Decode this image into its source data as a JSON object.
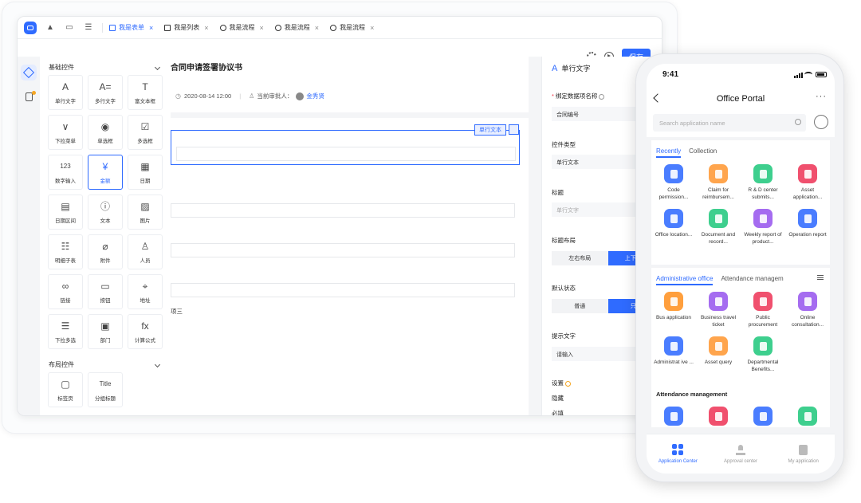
{
  "designer": {
    "tabs": [
      {
        "label": "我是表单",
        "active": true
      },
      {
        "label": "我是列表",
        "active": false
      },
      {
        "label": "我是流程",
        "active": false
      },
      {
        "label": "我是流程",
        "active": false
      },
      {
        "label": "我是流程",
        "active": false
      }
    ],
    "save_label": "保存",
    "palette": {
      "basic_header": "基础控件",
      "basic_items": [
        {
          "glyph": "A",
          "label": "单行文字"
        },
        {
          "glyph": "A=",
          "label": "多行文字"
        },
        {
          "glyph": "T",
          "label": "富文本框"
        },
        {
          "glyph": "∨",
          "label": "下拉菜单"
        },
        {
          "glyph": "◉",
          "label": "单选框"
        },
        {
          "glyph": "☑",
          "label": "多选框"
        },
        {
          "glyph": "123",
          "label": "数字输入"
        },
        {
          "glyph": "¥",
          "label": "金额",
          "selected": true
        },
        {
          "glyph": "▦",
          "label": "日期"
        },
        {
          "glyph": "▤",
          "label": "日期区间"
        },
        {
          "glyph": "ⓘ",
          "label": "文本"
        },
        {
          "glyph": "▨",
          "label": "图片"
        },
        {
          "glyph": "☷",
          "label": "明细子表"
        },
        {
          "glyph": "⌀",
          "label": "附件"
        },
        {
          "glyph": "♙",
          "label": "人员"
        },
        {
          "glyph": "∞",
          "label": "链接"
        },
        {
          "glyph": "▭",
          "label": "按钮"
        },
        {
          "glyph": "⌖",
          "label": "地址"
        },
        {
          "glyph": "☰",
          "label": "下拉多选"
        },
        {
          "glyph": "▣",
          "label": "部门"
        },
        {
          "glyph": "fx",
          "label": "计算公式"
        }
      ],
      "layout_header": "布局控件",
      "layout_items": [
        {
          "glyph": "▢",
          "label": "标签页"
        },
        {
          "glyph": "Title",
          "label": "分组标题"
        }
      ]
    },
    "form": {
      "title": "合同申请签署协议书",
      "date": "2020-08-14 12:00",
      "approver_label": "当前审批人：",
      "approver_name": "金秀贤",
      "selected_tag": "单行文本",
      "option_text": "项三"
    },
    "properties": {
      "title": "单行文字",
      "bind_label": "绑定数据项名称",
      "bind_value": "合同编号",
      "type_label": "控件类型",
      "type_value": "单行文本",
      "caption_label": "标题",
      "caption_placeholder": "单行文字",
      "layout_label": "标题布局",
      "layout_options": [
        "左右布局",
        "上下布局"
      ],
      "default_label": "默认状态",
      "default_options": [
        "普通",
        "只读"
      ],
      "hint_label": "提示文字",
      "hint_value": "请输入",
      "settings_label": "设置",
      "hidden_label": "隐藏",
      "required_label": "必填"
    }
  },
  "phone": {
    "time": "9:41",
    "title": "Office Portal",
    "more": "···",
    "search_placeholder": "Search application name",
    "recent_tabs": [
      "Recently",
      "Collection"
    ],
    "recent_apps": [
      {
        "label": "Code permission...",
        "color": "#4a7dff"
      },
      {
        "label": "Claim for reimbursem...",
        "color": "#ffa54d"
      },
      {
        "label": "R & D center submits...",
        "color": "#3ecf8e"
      },
      {
        "label": "Asset application...",
        "color": "#f0506e"
      },
      {
        "label": "Office location...",
        "color": "#4a7dff"
      },
      {
        "label": "Document and record...",
        "color": "#3ecf8e"
      },
      {
        "label": "Weekly report of product...",
        "color": "#a56cf0"
      },
      {
        "label": "Operation report",
        "color": "#4a7dff"
      }
    ],
    "admin_tabs": [
      "Administrative office",
      "Attendance managem"
    ],
    "admin_apps": [
      {
        "label": "Bus application",
        "color": "#ff9f3d"
      },
      {
        "label": "Business travel ticket",
        "color": "#a56cf0"
      },
      {
        "label": "Public procurement",
        "color": "#f0506e"
      },
      {
        "label": "Online consultation...",
        "color": "#a56cf0"
      },
      {
        "label": "Administrat ive ...",
        "color": "#4a7dff"
      },
      {
        "label": "Asset query",
        "color": "#ffa54d"
      },
      {
        "label": "Departmental Benefits...",
        "color": "#3ecf8e"
      }
    ],
    "attendance_title": "Attendance management",
    "attendance_apps": [
      {
        "color": "#4a7dff"
      },
      {
        "color": "#f0506e"
      },
      {
        "color": "#4a7dff"
      },
      {
        "color": "#3ecf8e"
      }
    ],
    "bottom_nav": [
      "Application Center",
      "Approval center",
      "My application"
    ]
  }
}
